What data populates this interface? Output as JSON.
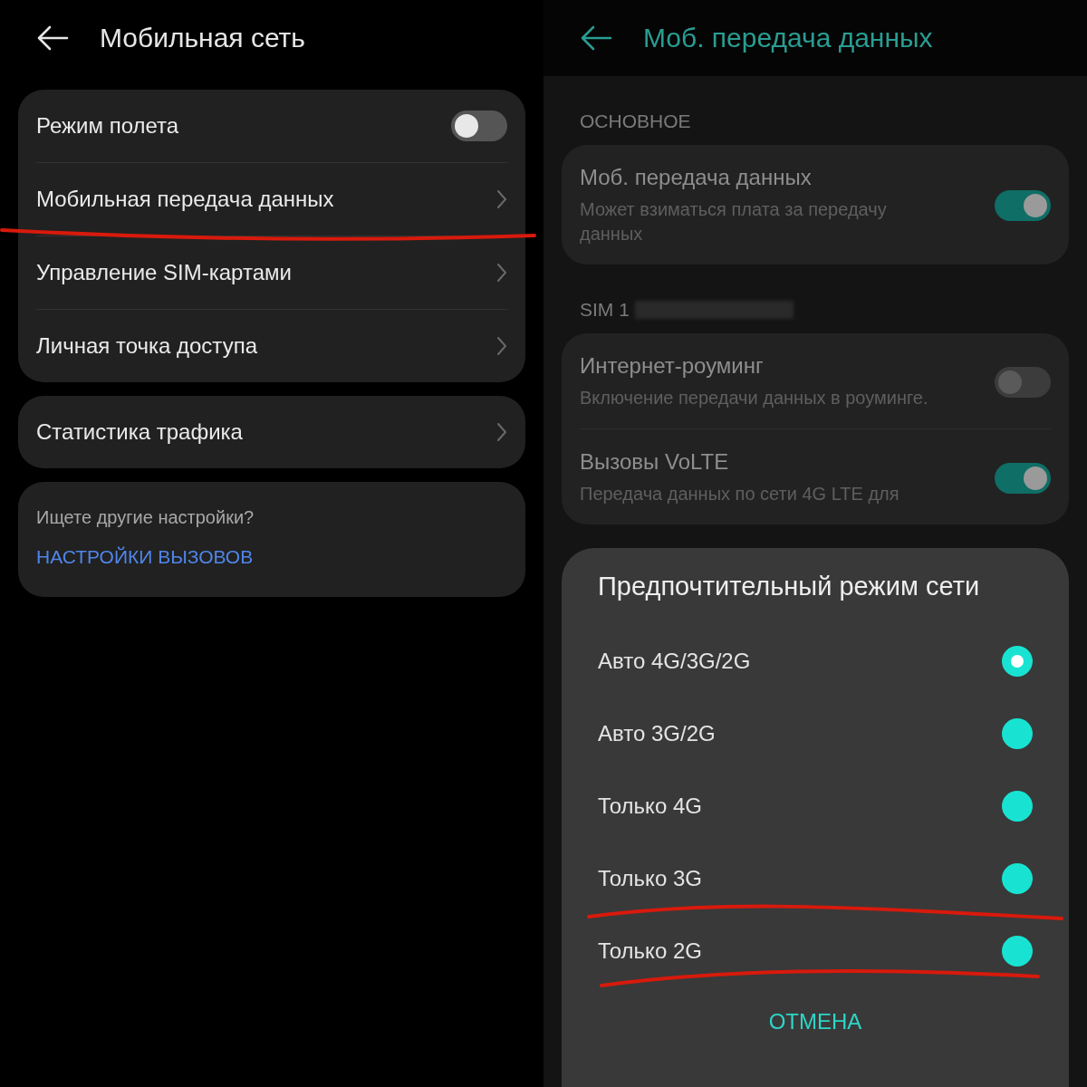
{
  "left": {
    "title": "Мобильная сеть",
    "groups": [
      {
        "items": [
          {
            "label": "Режим полета",
            "kind": "toggle",
            "on": false
          },
          {
            "label": "Мобильная передача данных",
            "kind": "link"
          },
          {
            "label": "Управление SIM-картами",
            "kind": "link"
          },
          {
            "label": "Личная точка доступа",
            "kind": "link"
          }
        ]
      },
      {
        "items": [
          {
            "label": "Статистика трафика",
            "kind": "link"
          }
        ]
      }
    ],
    "more": {
      "hint": "Ищете другие настройки?",
      "link": "НАСТРОЙКИ ВЫЗОВОВ"
    }
  },
  "right": {
    "title": "Моб. передача данных",
    "sections": [
      {
        "header": "ОСНОВНОЕ",
        "redacted": false,
        "items": [
          {
            "label": "Моб. передача данных",
            "description": "Может взиматься плата за передачу данных",
            "on": true
          }
        ]
      },
      {
        "header": "SIM 1",
        "redacted": true,
        "items": [
          {
            "label": "Интернет-роуминг",
            "description": "Включение передачи данных в роуминге.",
            "on": false
          },
          {
            "label": "Вызовы VoLTE",
            "description": "Передача данных по сети 4G LTE для",
            "on": true
          }
        ]
      }
    ],
    "dialog": {
      "title": "Предпочтительный режим сети",
      "options": [
        {
          "label": "Авто 4G/3G/2G",
          "selected": true
        },
        {
          "label": "Авто 3G/2G",
          "selected": false
        },
        {
          "label": "Только 4G",
          "selected": false
        },
        {
          "label": "Только 3G",
          "selected": false
        },
        {
          "label": "Только 2G",
          "selected": false
        }
      ],
      "cancel": "ОТМЕНА"
    }
  }
}
